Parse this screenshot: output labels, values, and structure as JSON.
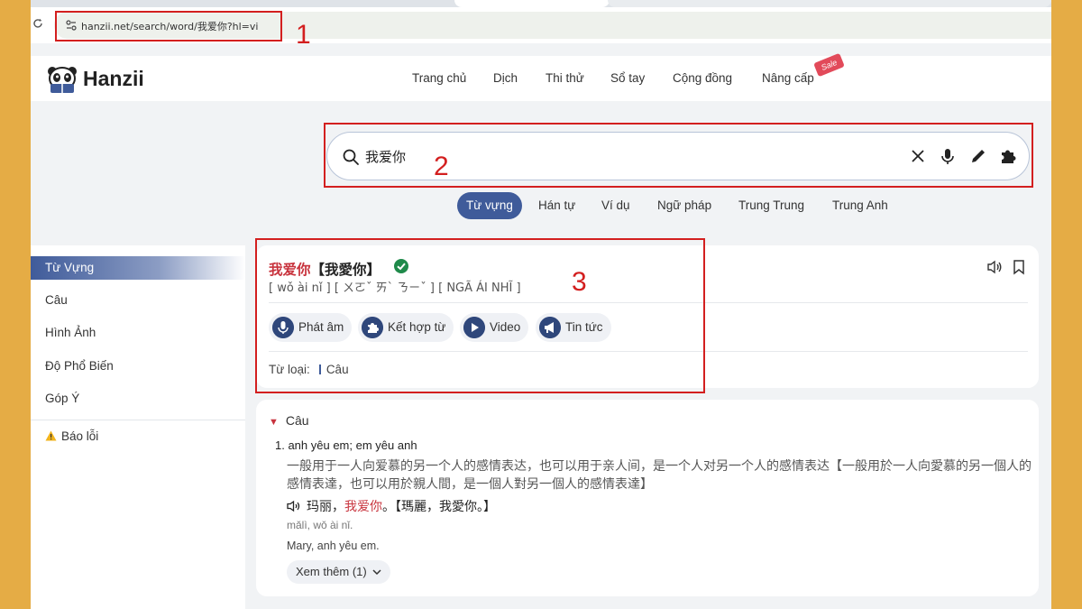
{
  "browser": {
    "url": "hanzii.net/search/word/我爱你?hl=vi"
  },
  "annotations": {
    "one": "1",
    "two": "2",
    "three": "3"
  },
  "header": {
    "brand": "Hanzii",
    "nav": [
      "Trang chủ",
      "Dịch",
      "Thi thử",
      "Sổ tay",
      "Cộng đồng",
      "Nâng cấp"
    ],
    "sale_badge": "Sale"
  },
  "search": {
    "query": "我爱你",
    "tabs": [
      "Từ vựng",
      "Hán tự",
      "Ví dụ",
      "Ngữ pháp",
      "Trung Trung",
      "Trung Anh"
    ],
    "active_tab": "Từ vựng"
  },
  "sidebar": {
    "items": [
      "Từ Vựng",
      "Câu",
      "Hình Ảnh",
      "Độ Phổ Biến",
      "Góp Ý"
    ],
    "active": "Từ Vựng",
    "report": "Báo lỗi"
  },
  "word": {
    "simplified": "我爱你",
    "traditional": "【我愛你】",
    "pronunciation": "[ wǒ ài nǐ ] [ ㄨㄛˇ ㄞˋ ㄋㄧˇ ] [ NGÃ ÁI NHĨ ]",
    "actions": [
      "Phát âm",
      "Kết hợp từ",
      "Video",
      "Tin tức"
    ],
    "word_type_label": "Từ loại:",
    "word_type": "Câu"
  },
  "section": {
    "heading": "Câu",
    "meaning": "1. anh yêu em; em yêu anh",
    "explanation": "一般用于一人向爱慕的另一个人的感情表达，也可以用于亲人间，是一个人对另一个人的感情表达【一般用於一人向愛慕的另一個人的感情表達，也可以用於親人間，是一個人對另一個人的感情表達】",
    "example_prefix": "玛丽，",
    "example_highlight": "我爱你",
    "example_suffix": "。【瑪麗，我愛你。】",
    "example_pinyin": "mǎlì, wǒ ài nǐ.",
    "example_translation": "Mary, anh yêu em.",
    "more_button": "Xem thêm (1)"
  },
  "colors": {
    "page_border": "#e5ac45",
    "accent": "#3f5b9a",
    "highlight": "#c8333d",
    "annotation": "#d31f1f"
  }
}
